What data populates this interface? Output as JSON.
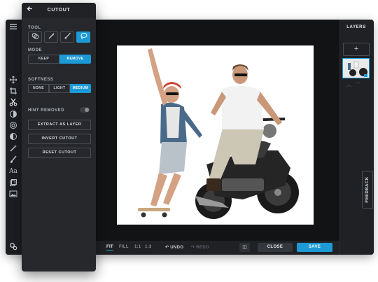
{
  "panel": {
    "title": "CUTOUT",
    "back_icon": "arrow-left-icon",
    "tool_label": "TOOL",
    "tools": [
      {
        "icon": "circles-icon",
        "active": false
      },
      {
        "icon": "magic-wand-icon",
        "active": false
      },
      {
        "icon": "brush-icon",
        "active": false
      },
      {
        "icon": "lasso-icon",
        "active": true
      }
    ],
    "mode_label": "MODE",
    "modes": [
      {
        "label": "KEEP",
        "active": false
      },
      {
        "label": "REMOVE",
        "active": true
      }
    ],
    "softness_label": "SOFTNESS",
    "softness": [
      {
        "label": "NONE",
        "active": false
      },
      {
        "label": "LIGHT",
        "active": false
      },
      {
        "label": "MEDIUM",
        "active": true
      }
    ],
    "hint_label": "HINT REMOVED",
    "hint_on": false,
    "actions": [
      "EXTRACT AS LAYER",
      "INVERT CUTOUT",
      "RESET CUTOUT"
    ]
  },
  "rail": {
    "icons": [
      "menu-icon",
      "move-icon",
      "crop-icon",
      "scissors-icon",
      "adjust-icon",
      "filter-icon",
      "contrast-icon",
      "wand-icon",
      "brush-icon",
      "text-icon",
      "layers-icon",
      "image-icon",
      "settings-icon"
    ]
  },
  "bottom": {
    "zoom": [
      {
        "label": "FIT",
        "active": true
      },
      {
        "label": "FILL",
        "active": false
      },
      {
        "label": "1:1",
        "active": false
      },
      {
        "label": "1:3",
        "active": false
      }
    ],
    "undo": "UNDO",
    "redo": "REDO",
    "close": "CLOSE",
    "save": "SAVE"
  },
  "layers": {
    "title": "LAYERS",
    "add": "+"
  },
  "feedback": "FEEDBACK",
  "colors": {
    "accent": "#1c9ad6",
    "panel": "#26282c",
    "app": "#1f2124",
    "canvas": "#121315"
  }
}
